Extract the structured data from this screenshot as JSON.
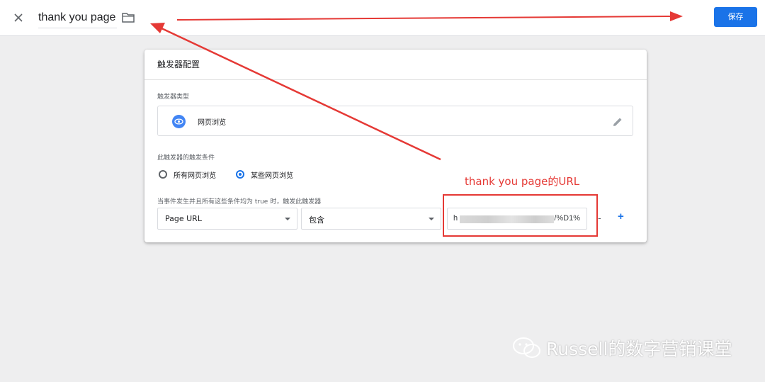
{
  "header": {
    "title": "thank you page",
    "save_label": "保存",
    "close_icon": "close-icon",
    "folder_icon": "folder-icon",
    "accent_color": "#1a73e8"
  },
  "card": {
    "title": "触发器配置",
    "trigger_type_label": "触发器类型",
    "trigger_type_value": "网页浏览",
    "trigger_type_icon": "eye-icon",
    "edit_icon": "pencil-icon",
    "condition_label": "此触发器的触发条件",
    "radio_options": [
      {
        "label": "所有网页浏览",
        "checked": false
      },
      {
        "label": "某些网页浏览",
        "checked": true
      }
    ],
    "filter_label": "当事件发生并且所有这些条件均为 true 时，触发此触发器",
    "filter": {
      "variable": "Page URL",
      "operator": "包含",
      "value_prefix": "h",
      "value_suffix": "/%D1%",
      "remove_label": "-",
      "add_label": "+"
    }
  },
  "annotation": {
    "text": "thank you page的URL",
    "color": "#e53935"
  },
  "watermark": {
    "text": "Russell的数字营销课堂",
    "icon": "wechat-icon"
  }
}
